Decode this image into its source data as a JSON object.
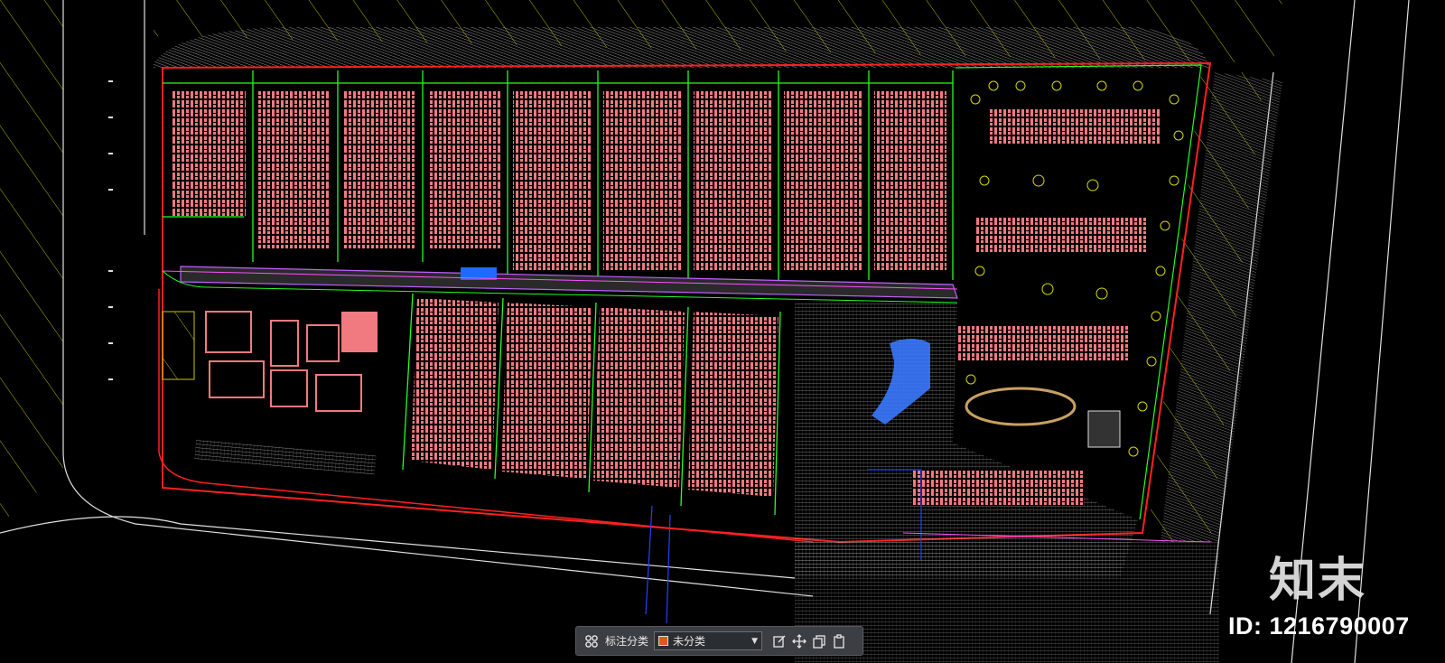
{
  "toolbar": {
    "label": "标注分类",
    "category_value": "未分类",
    "category_color": "#e8541e",
    "icons": [
      "categories-icon",
      "edit-icon",
      "move-icon",
      "copy-icon",
      "paste-icon"
    ]
  },
  "watermark": {
    "logo_text": "知末",
    "id_text": "ID: 1216790007"
  },
  "colors": {
    "background": "#000000",
    "building": "#f07a80",
    "green_line": "#22ff22",
    "boundary_red": "#ff2020",
    "road_gray": "#9a9a9a",
    "yellow_hatch": "#c8c800",
    "water_blue": "#3a78ff"
  }
}
